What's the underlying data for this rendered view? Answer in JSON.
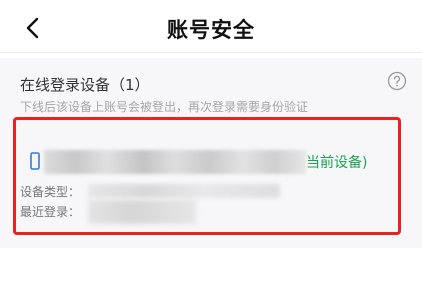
{
  "header": {
    "title": "账号安全",
    "back_icon": "chevron-left-icon"
  },
  "online_devices": {
    "title": "在线登录设备（1）",
    "description": "下线后该设备上账号会被登出，再次登录需要身份验证",
    "help_icon": "question-circle-icon"
  },
  "device": {
    "current_tag": "当前设备)",
    "type_label": "设备类型：",
    "recent_login_label": "最近登录："
  },
  "colors": {
    "highlight_border": "#e8221c",
    "current_device_text": "#1ba34f",
    "section_background": "#f7f7f9"
  }
}
